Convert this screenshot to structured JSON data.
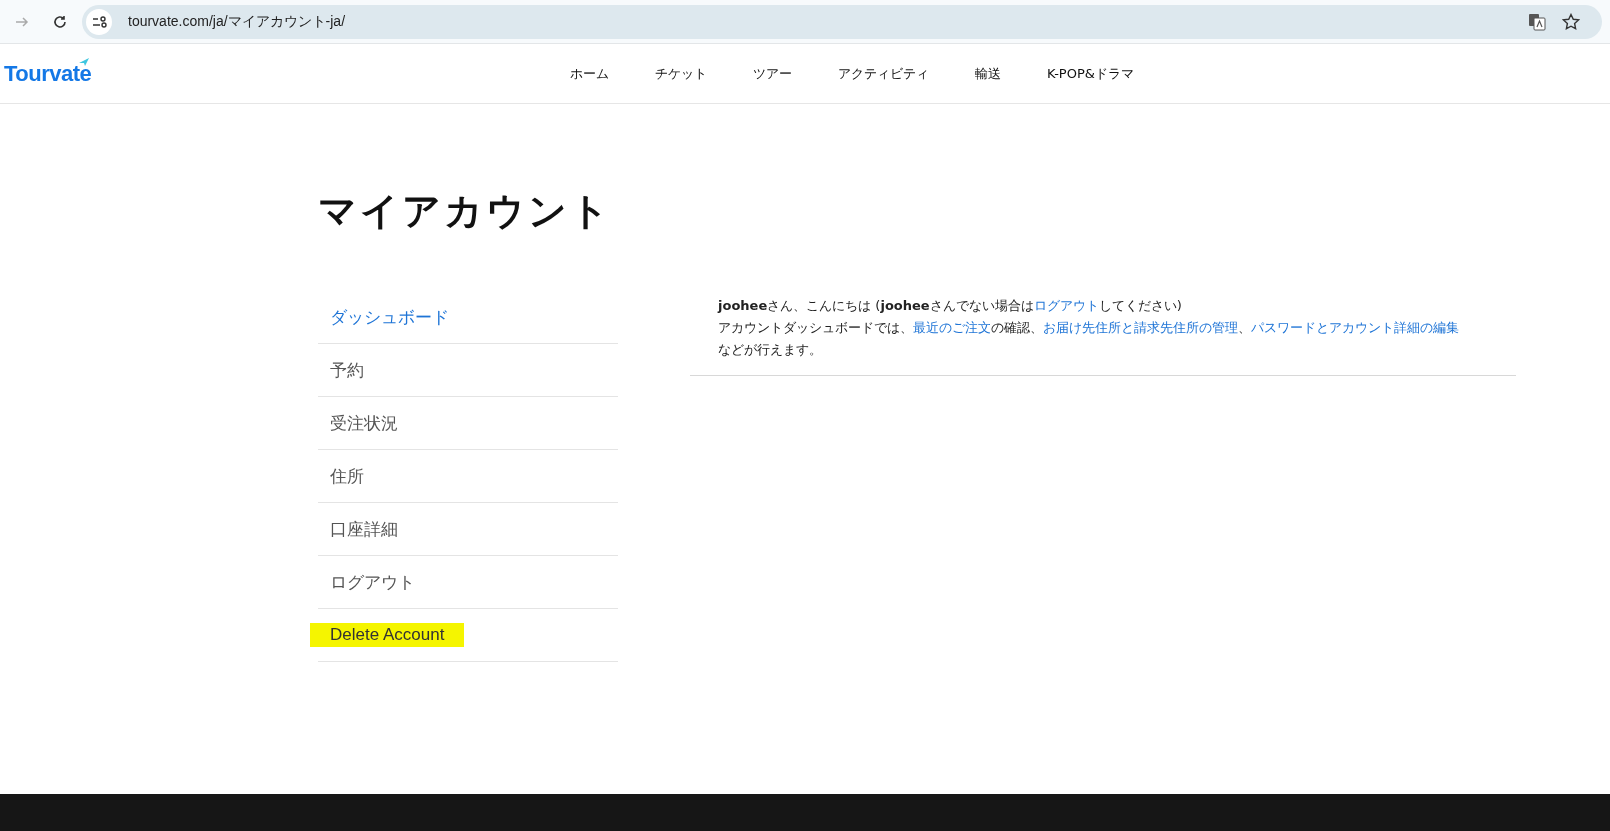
{
  "browser": {
    "url": "tourvate.com/ja/マイアカウント-ja/",
    "back_enabled": false
  },
  "header": {
    "logo": "Tourvate",
    "nav": [
      "ホーム",
      "チケット",
      "ツアー",
      "アクティビティ",
      "輸送",
      "K-POP&ドラマ"
    ]
  },
  "page": {
    "title": "マイアカウント"
  },
  "sidebar": {
    "items": [
      {
        "label": "ダッシュボード",
        "selected": true,
        "highlighted": false
      },
      {
        "label": "予約",
        "selected": false,
        "highlighted": false
      },
      {
        "label": "受注状況",
        "selected": false,
        "highlighted": false
      },
      {
        "label": "住所",
        "selected": false,
        "highlighted": false
      },
      {
        "label": "口座詳細",
        "selected": false,
        "highlighted": false
      },
      {
        "label": "ログアウト",
        "selected": false,
        "highlighted": false
      },
      {
        "label": "Delete Account",
        "selected": false,
        "highlighted": true
      }
    ]
  },
  "content": {
    "paragraphs": [
      [
        {
          "text": "**joohee**さん、こんにちは (**joohee**さんでない場合は",
          "link": false
        },
        {
          "text": "ログアウト",
          "link": true
        },
        {
          "text": "してください)",
          "link": false
        }
      ],
      [
        {
          "text": "アカウントダッシュボードでは、",
          "link": false
        },
        {
          "text": "最近のご注文",
          "link": true
        },
        {
          "text": "の確認、",
          "link": false
        },
        {
          "text": "お届け先住所と請求先住所の管理",
          "link": true
        },
        {
          "text": "、",
          "link": false
        },
        {
          "text": "パスワードとアカウント詳細の編集",
          "link": true
        },
        {
          "text": "などが行えます。",
          "link": false
        }
      ]
    ]
  }
}
